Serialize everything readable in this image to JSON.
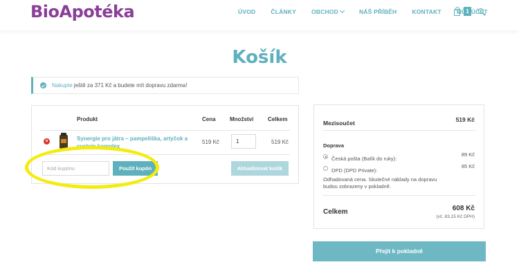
{
  "header": {
    "logo": "BioApotéka",
    "nav": [
      {
        "label": "ÚVOD"
      },
      {
        "label": "ČLÁNKY"
      },
      {
        "label": "OBCHOD"
      },
      {
        "label": "NÁŠ PŘÍBĚH"
      },
      {
        "label": "KONTAKT"
      },
      {
        "label": "MŮJ ÚČET"
      }
    ],
    "cart_count": "1"
  },
  "page": {
    "title": "Košík"
  },
  "notice": {
    "link": "Nakupte",
    "text": "ještě za 371 Kč a budete mít dopravu zdarma!"
  },
  "cart": {
    "headers": {
      "product": "Produkt",
      "price": "Cena",
      "quantity": "Množství",
      "total": "Celkem"
    },
    "item": {
      "name": "Synergie pro játra – pampeliška, artyčok a cystein komplex",
      "price": "519 Kč",
      "quantity": "1",
      "total": "519 Kč"
    },
    "coupon_placeholder": "Kód kupónu",
    "apply_coupon": "Použít kupón",
    "update_cart": "Aktualizovat košík"
  },
  "totals": {
    "subtotal_label": "Mezisoučet",
    "subtotal_value": "519 Kč",
    "shipping_label": "Doprava",
    "shipping_options": [
      {
        "label": "Česká pošta (Balík do ruky):",
        "price": "89 Kč",
        "selected": true
      },
      {
        "label": "DPD (DPD Private):",
        "price": "85 Kč",
        "selected": false
      }
    ],
    "shipping_note": "Odhadovaná cena. Skutečné náklady na dopravu budou zobrazeny v pokladně.",
    "total_label": "Celkem",
    "total_value": "608 Kč",
    "vat_note": "(vč. 83,15 Kč DPH)",
    "checkout": "Přejít k pokladně"
  },
  "colors": {
    "brand": "#8a3f97",
    "accent": "#5fb0bd",
    "remove": "#d9342b",
    "highlight": "#f4ec0f"
  }
}
